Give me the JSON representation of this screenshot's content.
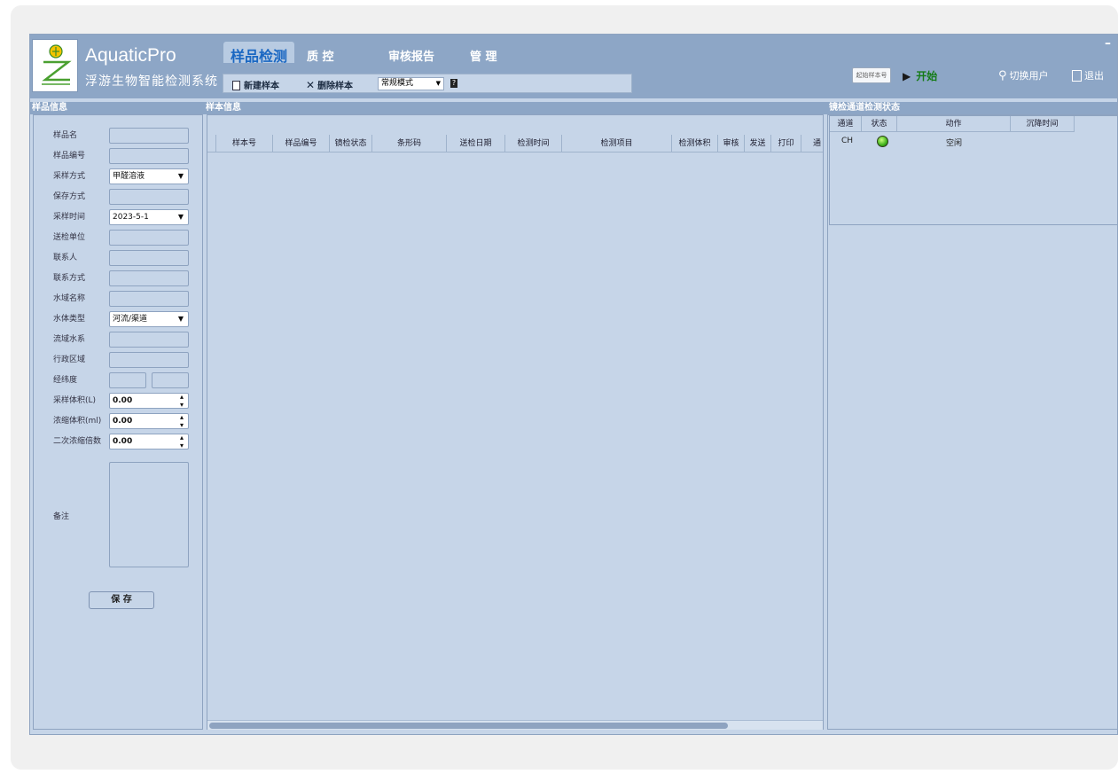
{
  "app": {
    "title": "AquaticPro",
    "subtitle": "浮游生物智能检测系统"
  },
  "tabs": [
    "样品检测",
    "质 控",
    "审核报告",
    "管 理"
  ],
  "ribbon": {
    "new_sample": "新建样本",
    "delete_sample": "删除样本",
    "mode_value": "常规模式"
  },
  "toolbar": {
    "start_sample_placeholder": "起始样本号",
    "start": "开始",
    "switch_user": "切换用户",
    "exit": "退出",
    "minimize": "–"
  },
  "left_panel": {
    "title": "样品信息",
    "fields": [
      {
        "label": "样品名",
        "type": "input",
        "value": ""
      },
      {
        "label": "样品编号",
        "type": "input",
        "value": ""
      },
      {
        "label": "采样方式",
        "type": "select",
        "value": "甲醛溶液"
      },
      {
        "label": "保存方式",
        "type": "input",
        "value": ""
      },
      {
        "label": "采样时间",
        "type": "select",
        "value": "2023-5-1"
      },
      {
        "label": "送检单位",
        "type": "input",
        "value": ""
      },
      {
        "label": "联系人",
        "type": "input",
        "value": ""
      },
      {
        "label": "联系方式",
        "type": "input",
        "value": ""
      },
      {
        "label": "水域名称",
        "type": "input",
        "value": ""
      },
      {
        "label": "水体类型",
        "type": "select",
        "value": "河流/渠道"
      },
      {
        "label": "流域水系",
        "type": "input",
        "value": ""
      },
      {
        "label": "行政区域",
        "type": "input",
        "value": ""
      },
      {
        "label": "经纬度",
        "type": "pair",
        "value": ""
      },
      {
        "label": "采样体积(L)",
        "type": "spin",
        "value": "0.00"
      },
      {
        "label": "浓缩体积(ml)",
        "type": "spin",
        "value": "0.00"
      },
      {
        "label": "二次浓缩倍数",
        "type": "spin",
        "value": "0.00"
      }
    ],
    "remark_label": "备注",
    "save_label": "保 存"
  },
  "center_panel": {
    "title": "样本信息",
    "columns": [
      "样本号",
      "样品编号",
      "镜检状态",
      "条形码",
      "送检日期",
      "检测时间",
      "检测项目",
      "检测体积",
      "审核",
      "发送",
      "打印",
      "通"
    ]
  },
  "right_panel": {
    "title": "镜检通道检测状态",
    "columns": [
      "通道",
      "状态",
      "动作",
      "沉降时间"
    ],
    "rows": [
      {
        "channel": "CH",
        "status": "green",
        "action": "空闲",
        "time": ""
      }
    ]
  },
  "colors": {
    "header": "#8da6c6",
    "panel_bg": "#c6d5e8",
    "active_tab_text": "#1a67c2",
    "start_green": "#157b17",
    "status_led": "#3fb11c"
  }
}
